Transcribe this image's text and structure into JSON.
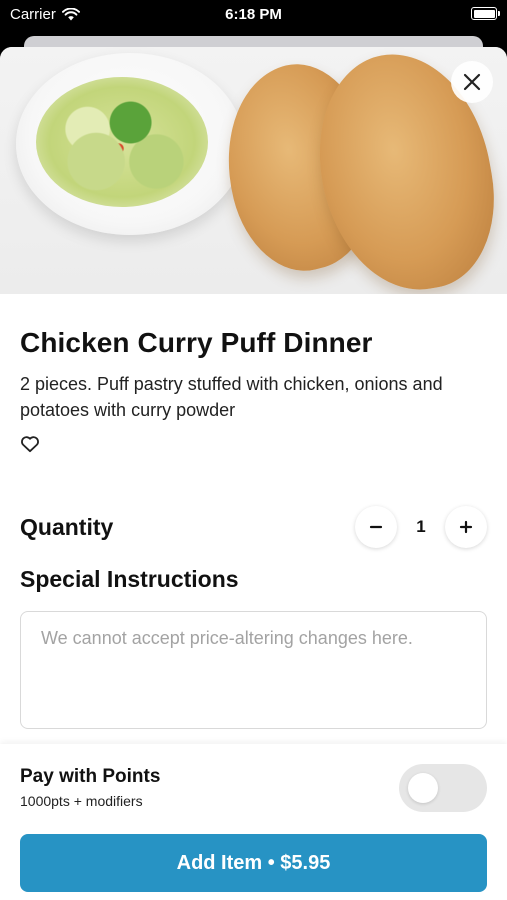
{
  "status_bar": {
    "carrier": "Carrier",
    "time": "6:18 PM"
  },
  "item": {
    "image": "chicken curry puffs with cucumber salad",
    "title": "Chicken Curry Puff Dinner",
    "description": "2 pieces. Puff pastry stuffed with chicken, onions and potatoes with curry powder",
    "favorite_icon": "heart-outline-icon"
  },
  "quantity": {
    "label": "Quantity",
    "value": "1",
    "decrement_icon": "minus-icon",
    "increment_icon": "plus-icon"
  },
  "special_instructions": {
    "label": "Special Instructions",
    "value": "",
    "placeholder": "We cannot accept price-altering changes here."
  },
  "points": {
    "label": "Pay with Points",
    "sublabel": "1000pts + modifiers",
    "enabled": false
  },
  "add_button": {
    "label": "Add Item • $5.95"
  },
  "colors": {
    "accent": "#2793c4"
  }
}
